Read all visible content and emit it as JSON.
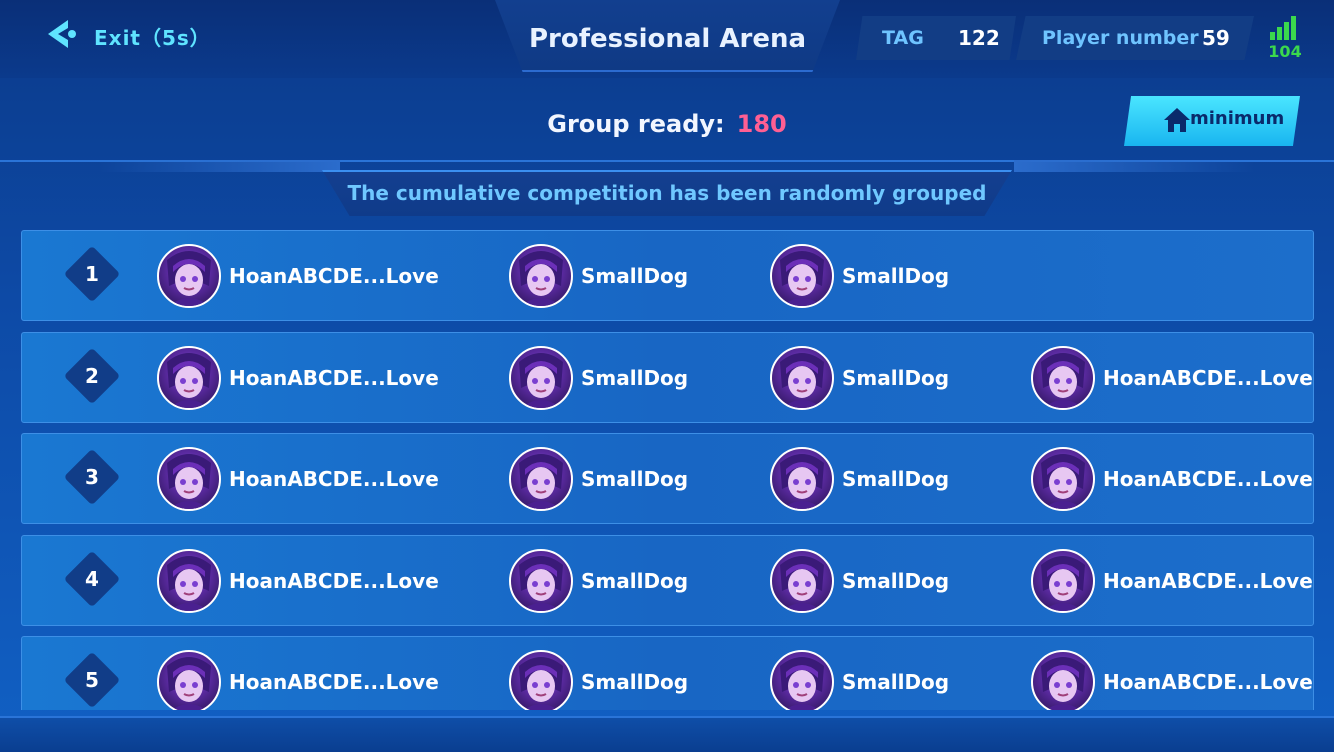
{
  "header": {
    "exit_label": "Exit（5s）",
    "title": "Professional Arena",
    "tag_label": "TAG",
    "tag_value": "122",
    "player_label": "Player number",
    "player_value": "59",
    "ping": "104"
  },
  "status": {
    "group_ready_label": "Group ready:",
    "group_ready_value": "180",
    "minimum_label": "minimum"
  },
  "banner": "The cumulative competition has been randomly grouped",
  "groups": [
    {
      "rank": "1",
      "players": [
        "HoanABCDE...Love",
        "SmallDog",
        "SmallDog"
      ]
    },
    {
      "rank": "2",
      "players": [
        "HoanABCDE...Love",
        "SmallDog",
        "SmallDog",
        "HoanABCDE...Love"
      ]
    },
    {
      "rank": "3",
      "players": [
        "HoanABCDE...Love",
        "SmallDog",
        "SmallDog",
        "HoanABCDE...Love"
      ]
    },
    {
      "rank": "4",
      "players": [
        "HoanABCDE...Love",
        "SmallDog",
        "SmallDog",
        "HoanABCDE...Love"
      ]
    },
    {
      "rank": "5",
      "players": [
        "HoanABCDE...Love",
        "SmallDog",
        "SmallDog",
        "HoanABCDE...Love"
      ]
    }
  ],
  "colors": {
    "accent": "#5fe4ff",
    "ready_value": "#ff5f93",
    "ping": "#3bd84d"
  }
}
